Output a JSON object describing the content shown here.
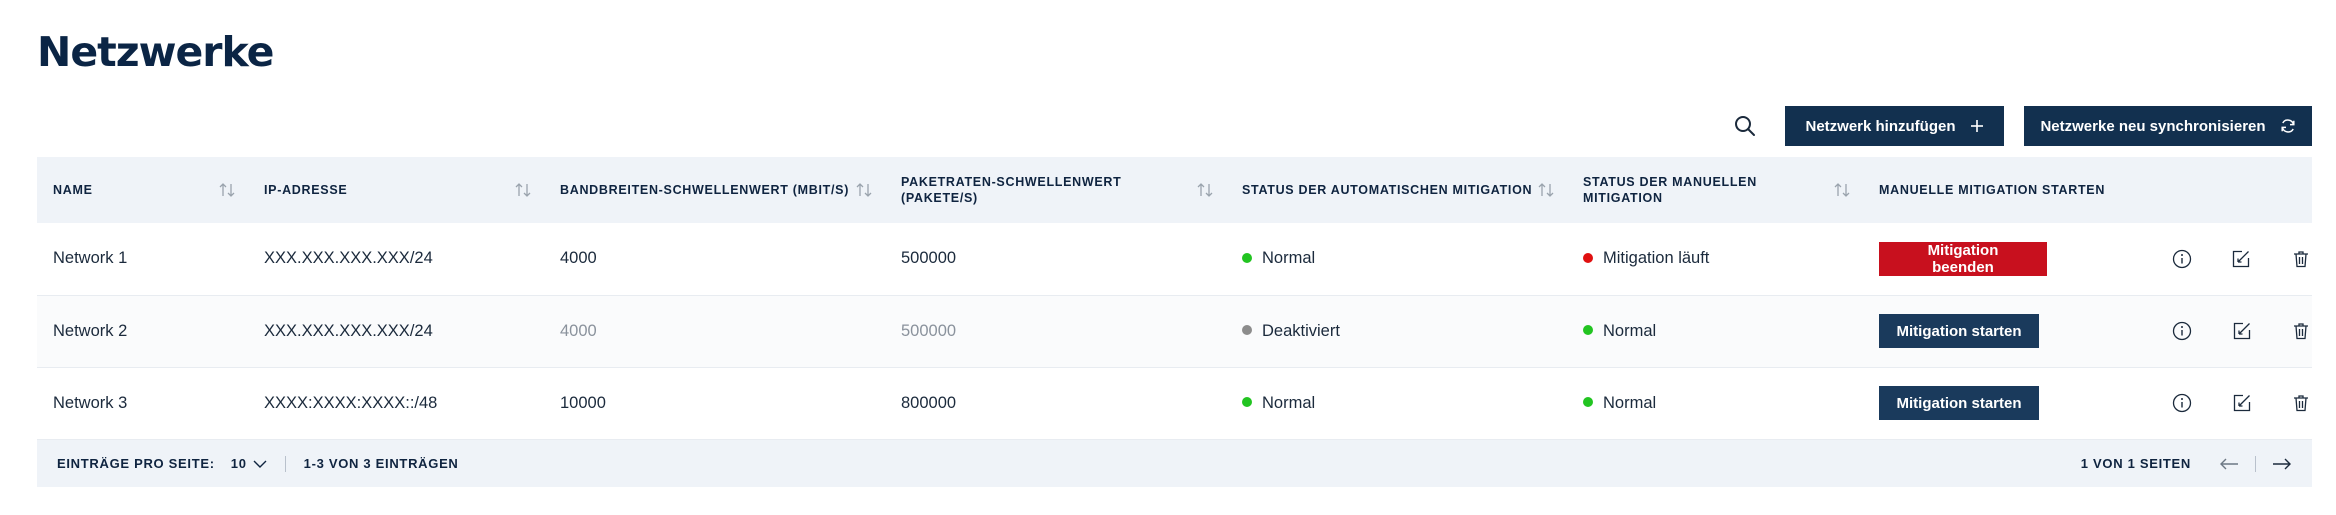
{
  "page": {
    "title": "Netzwerke"
  },
  "toolbar": {
    "search_icon": "search-icon",
    "add_label": "Netzwerk hinzufügen",
    "sync_label": "Netzwerke neu synchronisieren"
  },
  "table": {
    "columns": [
      {
        "label": "NAME",
        "sortable": true
      },
      {
        "label": "IP-ADRESSE",
        "sortable": true
      },
      {
        "label": "BANDBREITEN-SCHWELLENWERT (MBIT/S)",
        "sortable": true
      },
      {
        "label": "PAKETRATEN-SCHWELLENWERT (PAKETE/S)",
        "sortable": true
      },
      {
        "label": "STATUS DER AUTOMATISCHEN MITIGATION",
        "sortable": true
      },
      {
        "label": "STATUS DER MANUELLEN MITIGATION",
        "sortable": true
      },
      {
        "label": "MANUELLE MITIGATION STARTEN",
        "sortable": false
      }
    ],
    "rows": [
      {
        "name": "Network 1",
        "ip": "XXX.XXX.XXX.XXX/24",
        "bandwidth": "4000",
        "packets": "500000",
        "auto_status": "Normal",
        "manual_status": "Mitigation läuft",
        "action_label": "Mitigation beenden"
      },
      {
        "name": "Network 2",
        "ip": "XXX.XXX.XXX.XXX/24",
        "bandwidth": "4000",
        "packets": "500000",
        "auto_status": "Deaktiviert",
        "manual_status": "Normal",
        "action_label": "Mitigation starten"
      },
      {
        "name": "Network 3",
        "ip": "XXXX:XXXX:XXXX::/48",
        "bandwidth": "10000",
        "packets": "800000",
        "auto_status": "Normal",
        "manual_status": "Normal",
        "action_label": "Mitigation starten"
      }
    ]
  },
  "footer": {
    "per_page_label": "EINTRÄGE PRO SEITE:",
    "per_page_value": "10",
    "range_text": "1-3 VON 3 EINTRÄGEN",
    "page_text": "1 VON 1 SEITEN"
  },
  "colors": {
    "brand_dark": "#12304f",
    "danger": "#c8101e",
    "status_green": "#22c421",
    "status_red": "#e01010",
    "status_grey": "#8c8c8c"
  }
}
